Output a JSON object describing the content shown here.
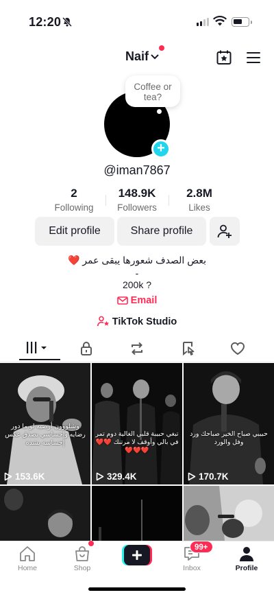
{
  "status_bar": {
    "time": "12:20"
  },
  "header": {
    "account_name": "Naif"
  },
  "profile": {
    "note": "Coffee or tea?",
    "username": "@iman7867",
    "stats": [
      {
        "value": "2",
        "label": "Following"
      },
      {
        "value": "148.9K",
        "label": "Followers"
      },
      {
        "value": "2.8M",
        "label": "Likes"
      }
    ],
    "edit_label": "Edit profile",
    "share_label": "Share profile",
    "bio_line1": "بعض الصدف شعورها يبقى عمر ❤️",
    "bio_line2": "-",
    "bio_line3": "200k ?",
    "email_label": "Email",
    "studio_label": "TikTok Studio"
  },
  "videos": [
    {
      "views": "153.6K",
      "caption": "وشلووون أرضيه لو ما دور رضايه وإحساسي بصدق عكس إحساسه بشده"
    },
    {
      "views": "329.4K",
      "caption": "تبغي حبيبة قلبي الغالية دوم تمر في بالي وأوقف لا مرتنك ❤️❤️❤️❤️❤️"
    },
    {
      "views": "170.7K",
      "caption": "حبيبي صباح الخير صباحك ورد وفل والورد"
    },
    {
      "views": "",
      "caption": ""
    },
    {
      "views": "",
      "caption": ""
    },
    {
      "views": "",
      "caption": ""
    }
  ],
  "bottom_nav": {
    "home": "Home",
    "shop": "Shop",
    "inbox": "Inbox",
    "inbox_badge": "99+",
    "profile": "Profile"
  },
  "colors": {
    "accent": "#fe2c55",
    "cyan": "#20d5ec"
  }
}
